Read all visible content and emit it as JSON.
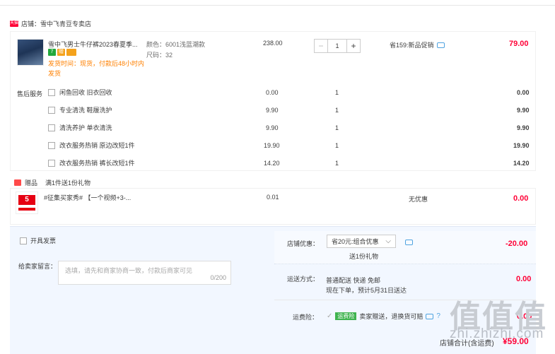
{
  "store": {
    "badge": "天猫",
    "name": "店铺：雪中飞青豆专卖店"
  },
  "product": {
    "title": "雪中飞男士牛仔裤2023春夏季...",
    "badges": [
      "7",
      "赠"
    ],
    "shipping": "发货时间：现货，付款后48小时内发货",
    "color": "颜色：6001浅蓝潮款",
    "size": "尺码：32",
    "unit_price": "238.00",
    "quantity": "1",
    "promo": "省159:新品促销",
    "subtotal": "79.00"
  },
  "after_sale": {
    "label": "售后服务",
    "items": [
      {
        "name": "闲鱼回收 旧衣回收",
        "price": "0.00",
        "qty": "1",
        "total": "0.00"
      },
      {
        "name": "专业清洗 鞋履洗护",
        "price": "9.90",
        "qty": "1",
        "total": "9.90"
      },
      {
        "name": "清洗养护 单衣清洗",
        "price": "9.90",
        "qty": "1",
        "total": "9.90"
      },
      {
        "name": "改衣服务热销 原边改短1件",
        "price": "19.90",
        "qty": "1",
        "total": "19.90"
      },
      {
        "name": "改衣服务热销 裤长改短1件",
        "price": "14.20",
        "qty": "1",
        "total": "14.20"
      }
    ]
  },
  "gift": {
    "label": "赠品",
    "rule": "满1件送1份礼物",
    "thumb_label": "5",
    "title": "#征集买家秀# 【一个视频+3-...",
    "price": "0.01",
    "promo": "无优惠",
    "total": "0.00"
  },
  "invoice": {
    "label": "开具发票"
  },
  "message": {
    "label": "给卖家留言：",
    "placeholder": "选填，请先和商家协商一致，付款后商家可见",
    "counter": "0/200"
  },
  "discount": {
    "label": "店铺优惠：",
    "selected": "省20元:组合优惠",
    "note": "送1份礼物",
    "amount": "-20.00"
  },
  "delivery": {
    "label": "运送方式：",
    "method": "普通配送 快递 免邮",
    "eta": "现在下单，预计5月31日送达",
    "amount": "0.00"
  },
  "insurance": {
    "label": "运费险：",
    "tag": "运费险",
    "text": "卖家赠送，退换货可赔",
    "amount": "0.00"
  },
  "total": {
    "label": "店铺合计(含运费)",
    "amount": "¥59.00"
  },
  "watermark": {
    "logo": "值值值",
    "url": "zhi.zhizhi.com"
  },
  "colors": {
    "accent": "#ff0036",
    "orange": "#ff8000",
    "blue": "#4fa3e0",
    "bottom_bg": "#f2f7ff"
  }
}
